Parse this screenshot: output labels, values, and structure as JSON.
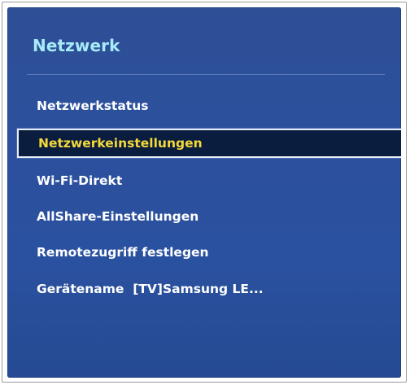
{
  "title": "Netzwerk",
  "menu": {
    "items": [
      {
        "label": "Netzwerkstatus",
        "selected": false
      },
      {
        "label": "Netzwerkeinstellungen",
        "selected": true
      },
      {
        "label": "Wi-Fi-Direkt",
        "selected": false
      },
      {
        "label": "AllShare-Einstellungen",
        "selected": false
      },
      {
        "label": "Remotezugriff festlegen",
        "selected": false
      },
      {
        "label": "Gerätename  [TV]Samsung LE...",
        "selected": false
      }
    ]
  },
  "colors": {
    "panel_background": "#2c509e",
    "title": "#a6ecf8",
    "item_text": "#ffffff",
    "selected_text": "#f4d93a",
    "selected_background": "#0b1d3e"
  }
}
